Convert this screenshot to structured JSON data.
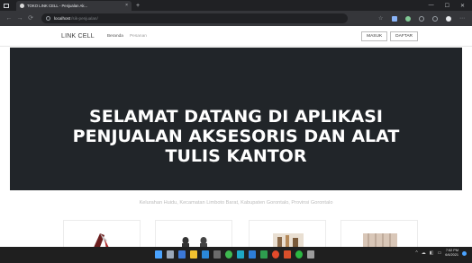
{
  "browser": {
    "tab_title": "TOKO LINK CELL - Penjualan Ak...",
    "tab_close": "×",
    "new_tab": "+",
    "window_controls": [
      "—",
      "☐",
      "✕"
    ],
    "nav_back": "←",
    "nav_forward": "→",
    "nav_reload": "⟳",
    "url_host": "localhost",
    "url_path": "/sik-penjualan/",
    "icons": [
      "star-icon",
      "extension-icon",
      "extension-icon",
      "history-icon",
      "account-icon",
      "avatar-icon",
      "menu-icon"
    ]
  },
  "site": {
    "brand": "LINK CELL",
    "nav": [
      "Beranda",
      "Pesanan"
    ],
    "login_label": "MASUK",
    "register_label": "DAFTAR"
  },
  "hero": {
    "title_lines": [
      "SELAMAT DATANG DI APLIKASI",
      "PENJUALAN AKSESORIS DAN ALAT",
      "TULIS KANTOR"
    ],
    "subtitle": "Kelurahan Huidu, Kecamatan Limboto Barat, Kabupaten Gorontalo, Provinsi Gorontalo"
  },
  "products": [
    "product-image",
    "product-image",
    "product-image",
    "product-image"
  ],
  "taskbar": {
    "tray_icons": [
      "^",
      "☁",
      "◧",
      "▭"
    ],
    "time": "7:52 PM",
    "date": "6/4/2021"
  },
  "colors": {
    "hero_bg": "#212529",
    "chrome_dark": "#202124",
    "chrome_toolbar": "#35363a",
    "taskbar": "#1f1f1f"
  }
}
